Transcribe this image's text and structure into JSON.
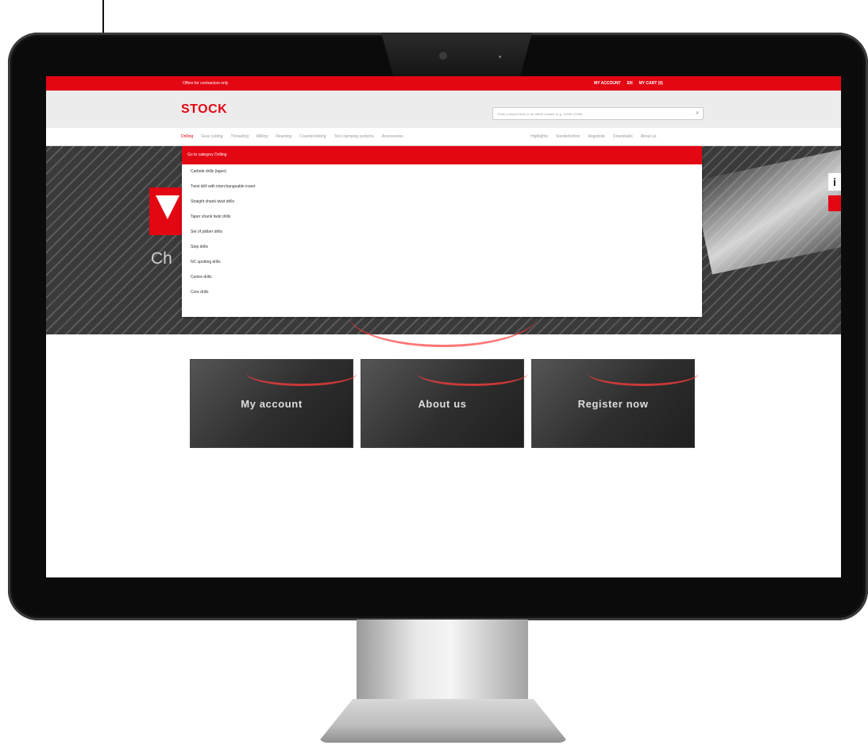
{
  "topbar": {
    "left_text": "Offers for contractors only",
    "links": [
      "MY ACCOUNT",
      "EN",
      "MY CART (0)"
    ]
  },
  "header": {
    "logo": "STOCK",
    "search_placeholder": "Enter a search term or an article number (e.g. 12345 12345)"
  },
  "nav": {
    "left": [
      "Drilling",
      "Gear cutting",
      "Threading",
      "Milling",
      "Reaming",
      "Countersinking",
      "Tool clamping systems",
      "Accessories"
    ],
    "right": [
      "Highlights",
      "Sonderbohrer",
      "Angebote",
      "Downloads",
      "About us"
    ]
  },
  "dropdown": {
    "header": "Go to category Drilling",
    "items": [
      "Carbide drills (taper)",
      "Twist drill with interchangeable insert",
      "Straight shank twist drills",
      "Taper shank twist drills",
      "Set of jobber drills",
      "Step drills",
      "NC spotting drills",
      "Centre drills",
      "Core drills"
    ]
  },
  "hero": {
    "headline": "Ch"
  },
  "tiles": [
    {
      "label": "My account"
    },
    {
      "label": "About us"
    },
    {
      "label": "Register now"
    }
  ],
  "side": {
    "info": "i"
  }
}
